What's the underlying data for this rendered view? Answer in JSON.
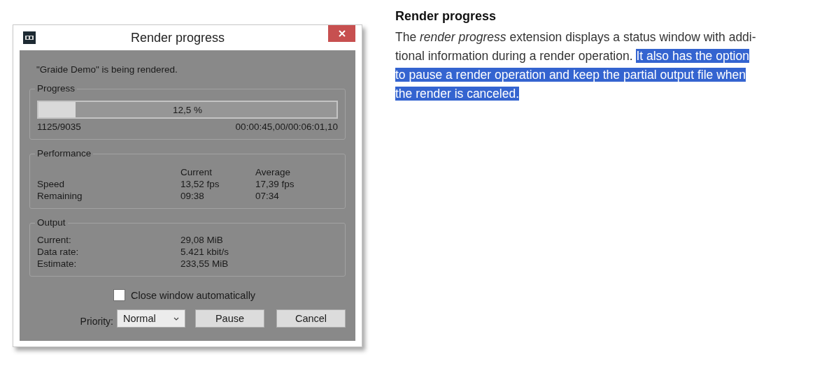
{
  "window": {
    "title": "Render progress"
  },
  "status_message": "\"Graide Demo\" is being rendered.",
  "progress": {
    "title": "Progress",
    "level": 0.125,
    "percent": "12,5 %",
    "frames": "1125/9035",
    "time": "00:00:45,00/00:06:01,10"
  },
  "performance": {
    "title": "Performance",
    "columns": [
      "Current",
      "Average"
    ],
    "rows": [
      {
        "label": "Speed",
        "current": "13,52 fps",
        "average": "17,39 fps"
      },
      {
        "label": "Remaining",
        "current": "09:38",
        "average": "07:34"
      }
    ]
  },
  "output": {
    "title": "Output",
    "rows": [
      {
        "label": "Current:",
        "value": "29,08 MiB"
      },
      {
        "label": "Data rate:",
        "value": "5.421 kbit/s"
      },
      {
        "label": "Estimate:",
        "value": "233,55 MiB"
      }
    ]
  },
  "close_automatically": {
    "label": "Close window automatically",
    "checked": false
  },
  "priority": {
    "label": "Priority:",
    "value": "Normal"
  },
  "buttons": [
    "Pause",
    "Cancel"
  ],
  "article": {
    "heading": "Render progress",
    "segments": [
      {
        "text": "The *render progress* extension displays a status window with addi-tional information during a render operation. ",
        "selected": false
      },
      {
        "text": "It also has the option to pause a render operation and keep the partial output file when the render is canceled.",
        "selected": true
      }
    ]
  }
}
